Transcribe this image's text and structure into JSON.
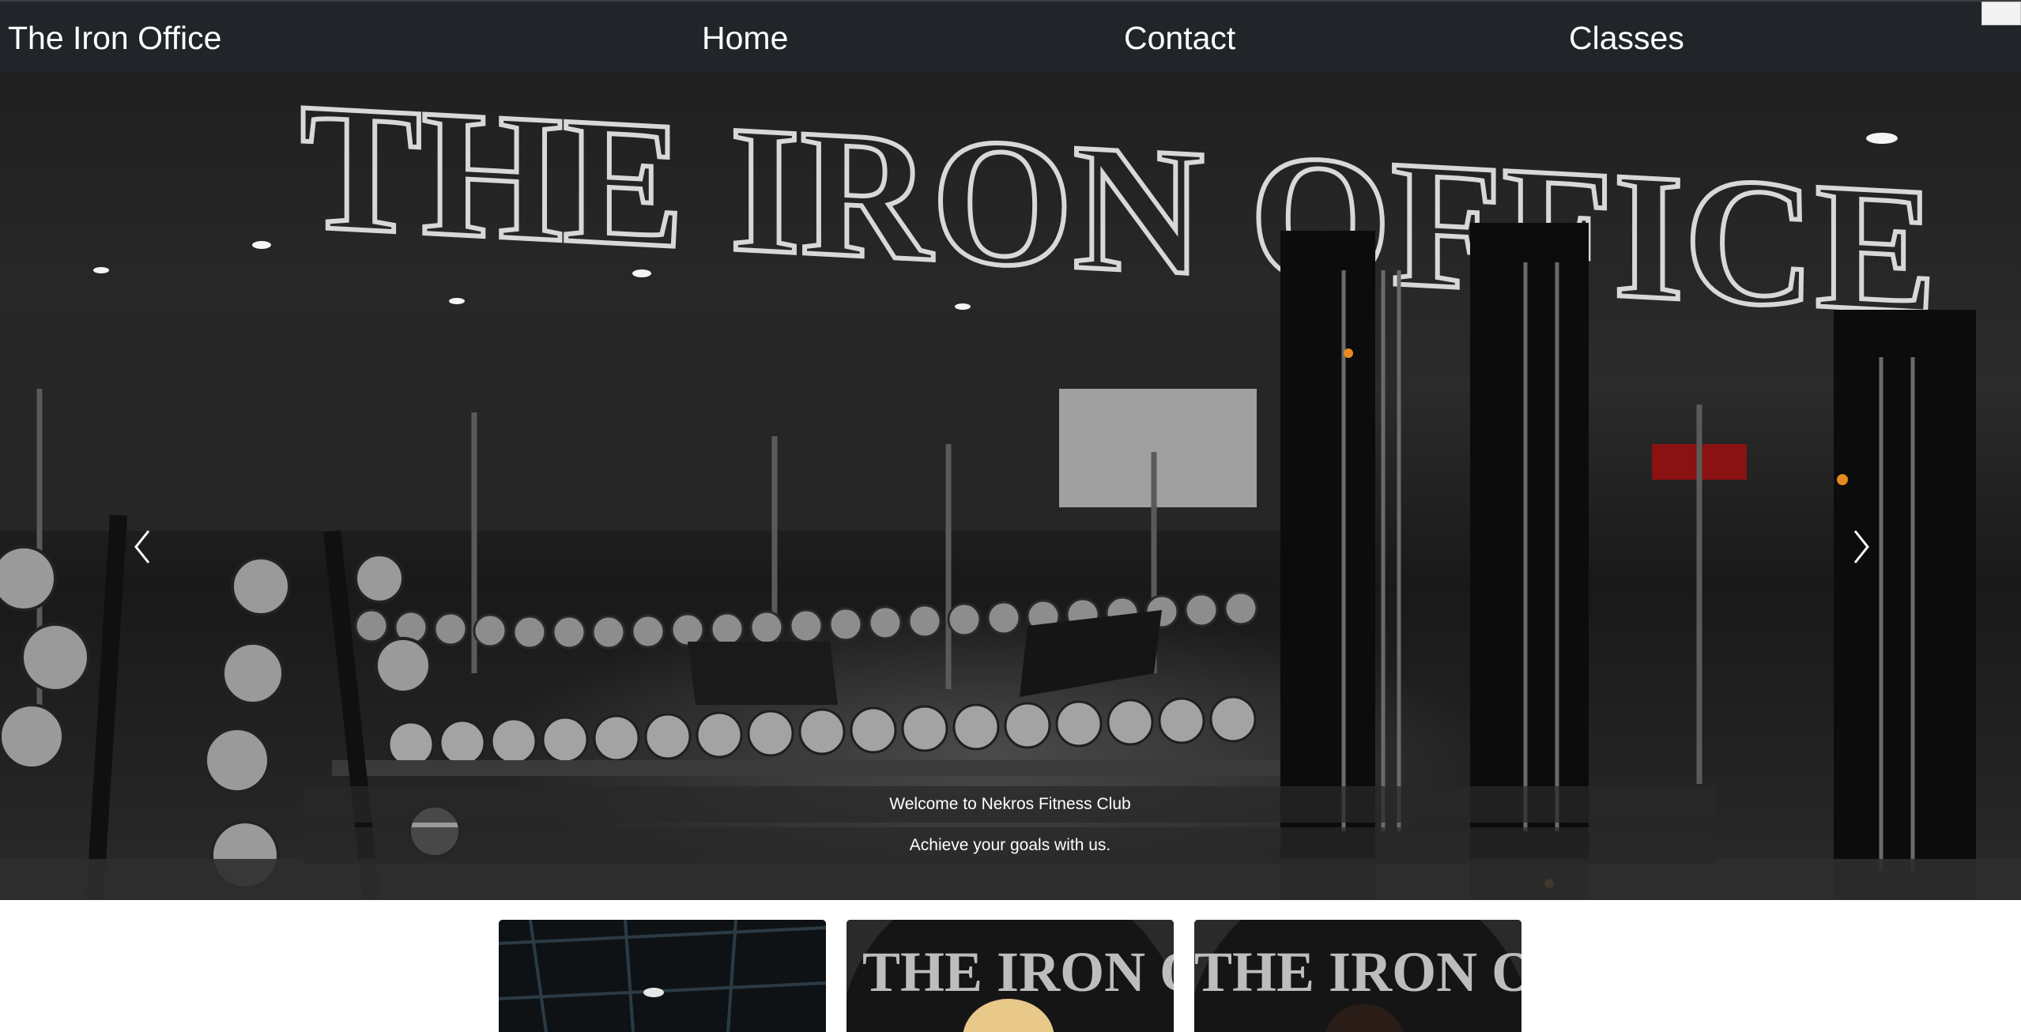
{
  "navbar": {
    "brand": "The Iron Office",
    "links": [
      "Home",
      "Contact",
      "Classes"
    ]
  },
  "hero": {
    "wall_sign": "THE IRON OFFICE",
    "caption_title": "Welcome to Nekros Fitness Club",
    "caption_text": "Achieve your goals with us.",
    "prev_icon": "chevron-left-icon",
    "next_icon": "chevron-right-icon"
  },
  "cards": [
    {
      "image": "gym-ceiling-photo"
    },
    {
      "image": "trainer-photo",
      "sign": "THE IRON OFFICE"
    },
    {
      "image": "trainer-photo",
      "sign": "THE IRON OFFICE"
    }
  ],
  "colors": {
    "navbar_bg": "#212529",
    "nav_text": "#ffffff",
    "caption_bg": "#282828"
  }
}
